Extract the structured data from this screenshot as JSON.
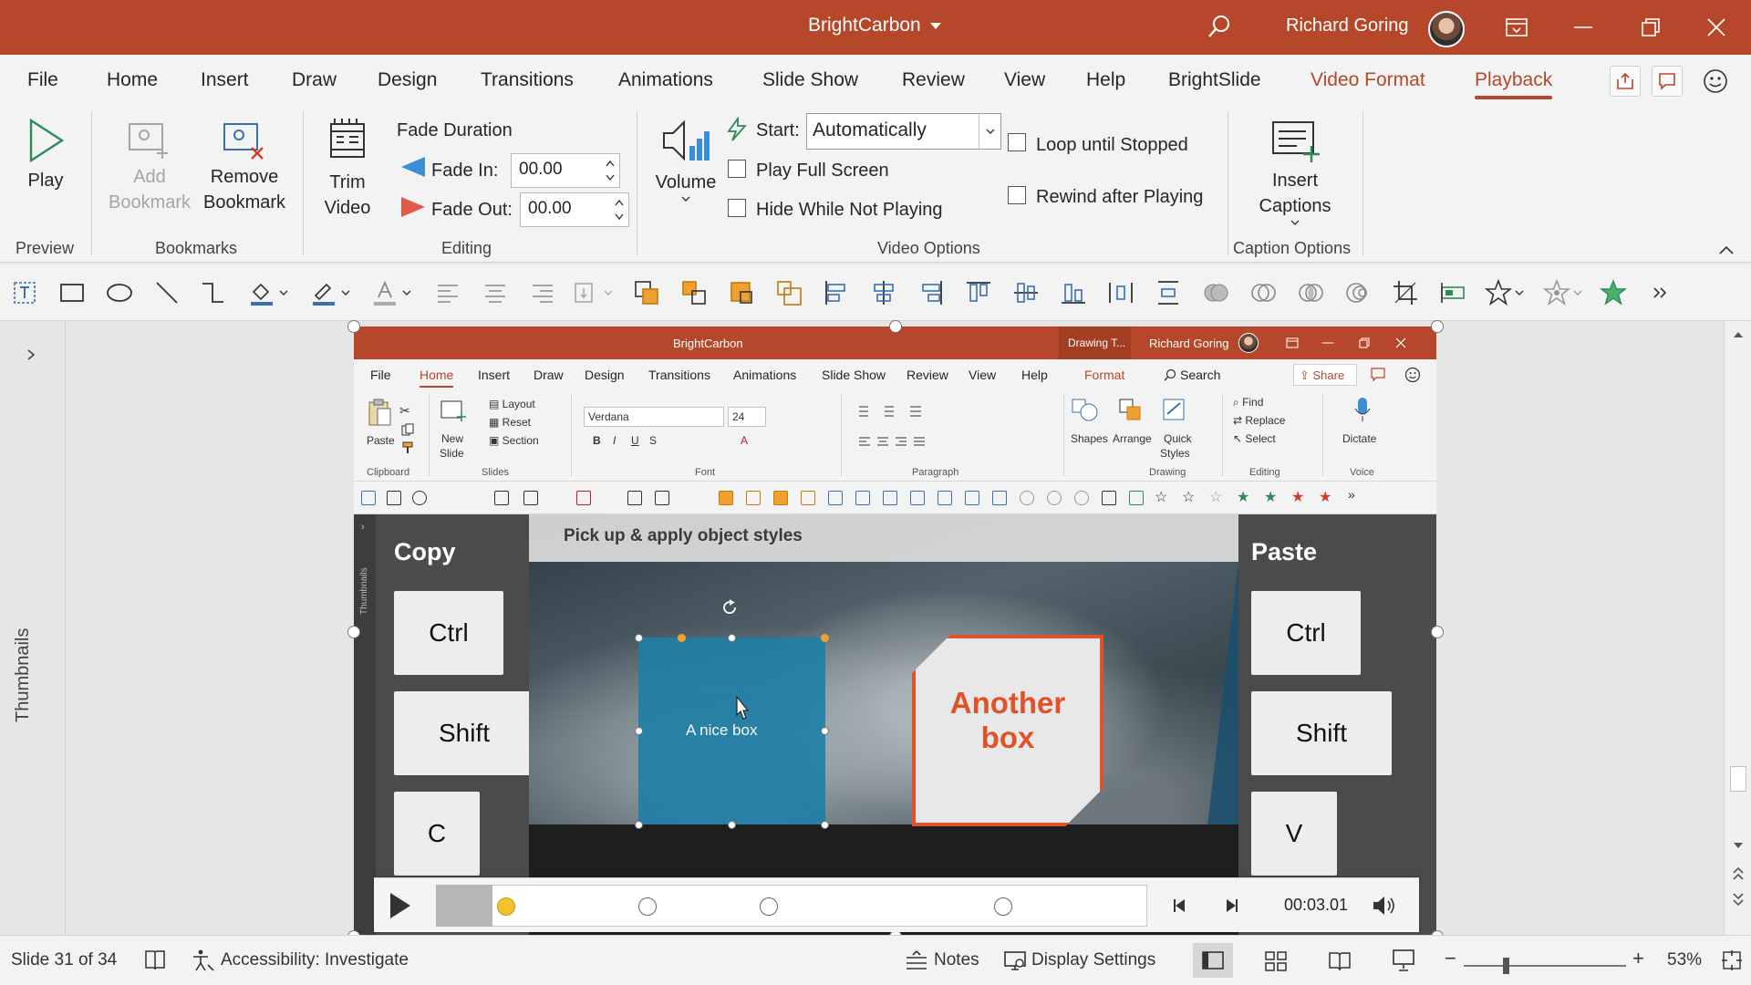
{
  "titlebar": {
    "doc_title": "BrightCarbon",
    "user_name": "Richard Goring"
  },
  "ribbon_tabs": [
    "File",
    "Home",
    "Insert",
    "Draw",
    "Design",
    "Transitions",
    "Animations",
    "Slide Show",
    "Review",
    "View",
    "Help",
    "BrightSlide",
    "Video Format",
    "Playback"
  ],
  "ribbon": {
    "preview": {
      "play": "Play",
      "group": "Preview"
    },
    "bookmarks": {
      "add1": "Add",
      "add2": "Bookmark",
      "remove1": "Remove",
      "remove2": "Bookmark",
      "group": "Bookmarks"
    },
    "editing": {
      "trim1": "Trim",
      "trim2": "Video",
      "fade_duration": "Fade Duration",
      "fade_in_label": "Fade In:",
      "fade_in_value": "00.00",
      "fade_out_label": "Fade Out:",
      "fade_out_value": "00.00",
      "group": "Editing"
    },
    "video_options": {
      "volume": "Volume",
      "start_label": "Start:",
      "start_value": "Automatically",
      "play_full_screen": "Play Full Screen",
      "hide_while_not_playing": "Hide While Not Playing",
      "loop_until_stopped": "Loop until Stopped",
      "rewind_after_playing": "Rewind after Playing",
      "group": "Video Options"
    },
    "caption_options": {
      "insert1": "Insert",
      "insert2": "Captions",
      "group": "Caption Options"
    }
  },
  "thumbnails_label": "Thumbnails",
  "video": {
    "title": "BrightCarbon",
    "context_tab": "Drawing T...",
    "user_name": "Richard Goring",
    "tabs": [
      "File",
      "Home",
      "Insert",
      "Draw",
      "Design",
      "Transitions",
      "Animations",
      "Slide Show",
      "Review",
      "View",
      "Help",
      "Format"
    ],
    "search": "Search",
    "share": "Share",
    "ribbon": {
      "paste": "Paste",
      "new_slide1": "New",
      "new_slide2": "Slide",
      "layout": "Layout",
      "reset": "Reset",
      "section": "Section",
      "font_name": "Verdana",
      "font_size": "24",
      "shapes": "Shapes",
      "arrange": "Arrange",
      "quick_styles1": "Quick",
      "quick_styles2": "Styles",
      "find": "Find",
      "replace": "Replace",
      "select": "Select",
      "dictate": "Dictate",
      "groups": {
        "clipboard": "Clipboard",
        "slides": "Slides",
        "font": "Font",
        "paragraph": "Paragraph",
        "drawing": "Drawing",
        "editing": "Editing",
        "voice": "Voice"
      }
    },
    "thumbs_label": "Thumbnails",
    "slide": {
      "banner": "Pick up & apply object styles",
      "copy_title": "Copy",
      "paste_title": "Paste",
      "copy_keys": [
        "Ctrl",
        "Shift",
        "C"
      ],
      "paste_keys": [
        "Ctrl",
        "Shift",
        "V"
      ],
      "nice_box": "A nice box",
      "another_box_line1": "Another",
      "another_box_line2": "box"
    }
  },
  "media": {
    "time": "00:03.01",
    "progress_fraction": 0.08
  },
  "status": {
    "slide": "Slide 31 of 34",
    "accessibility": "Accessibility: Investigate",
    "notes": "Notes",
    "display_settings": "Display Settings",
    "zoom": "53%"
  },
  "colors": {
    "accent": "#b7472a",
    "box_teal": "#1e7fa6",
    "box_orange": "#e0532a"
  }
}
